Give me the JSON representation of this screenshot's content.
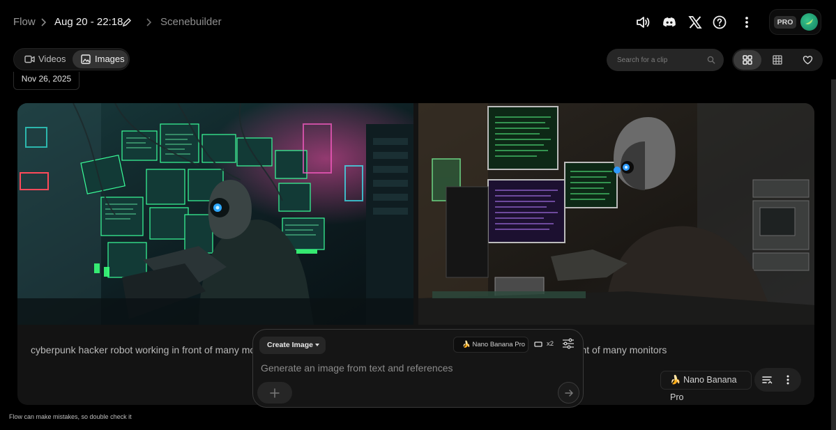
{
  "header": {
    "breadcrumb": [
      "Flow",
      "Aug 20 - 22:18",
      "Scenebuilder"
    ],
    "icons": [
      "volume-icon",
      "discord-icon",
      "x-logo-icon",
      "help-icon",
      "more-vertical-icon"
    ],
    "plan_badge": "PRO"
  },
  "toolbar": {
    "tabs": [
      {
        "label": "Videos",
        "icon": "video-icon",
        "selected": false
      },
      {
        "label": "Images",
        "icon": "image-icon",
        "selected": true
      }
    ],
    "date_group": "Nov 26, 2025",
    "search_placeholder": "Search for a clip",
    "view_modes": [
      "grid-view-icon",
      "table-view-icon",
      "favorites-icon"
    ],
    "active_view": "grid-view-icon"
  },
  "card": {
    "caption_left": "cyberpunk hacker robot working in front of many monitors",
    "caption_right": "cyberpunk hacker robot working in front of many monitors",
    "model": "Nano Banana Pro",
    "model_emoji": "🍌"
  },
  "composer": {
    "mode": "Create Image",
    "model": "Nano Banana Pro",
    "model_emoji": "🍌",
    "count": "x2",
    "placeholder": "Generate an image from text and references"
  },
  "footer": {
    "disclaimer": "Flow can make mistakes, so double check it"
  },
  "colors": {
    "background": "#000000",
    "card": "#131313",
    "monitor_green": "#48ff8c",
    "neon_pink": "#ff3d9a",
    "robot_eye_blue": "#2ea8ff",
    "avatar": "#1f9c6e"
  }
}
